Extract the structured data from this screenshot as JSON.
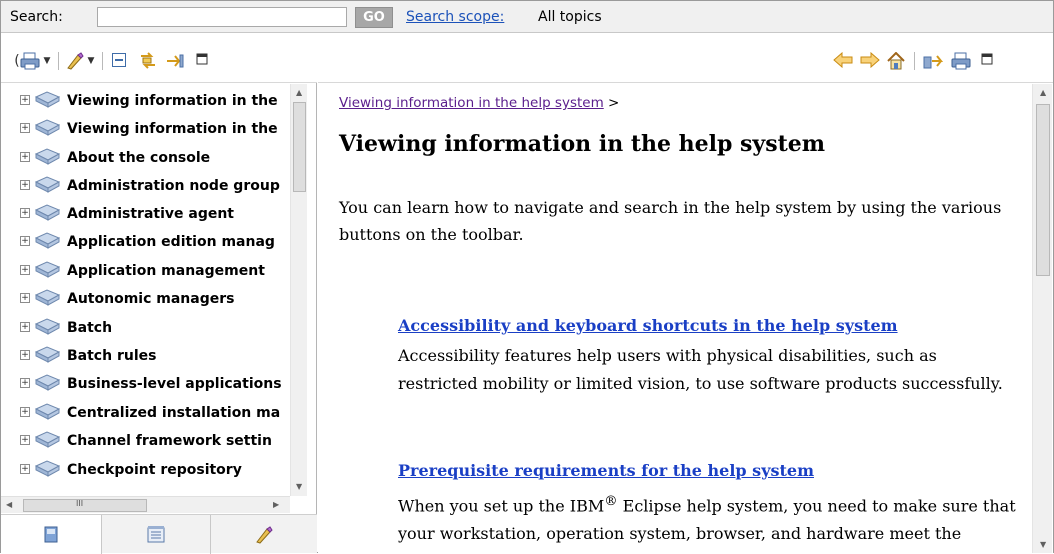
{
  "search": {
    "label": "Search:",
    "value": "",
    "placeholder": "",
    "go_label": "GO",
    "scope_link": "Search scope:",
    "scope_value": "All topics"
  },
  "toc": {
    "items": [
      {
        "label": "Viewing information in the"
      },
      {
        "label": "Viewing information in the"
      },
      {
        "label": "About the console"
      },
      {
        "label": "Administration node group"
      },
      {
        "label": "Administrative agent"
      },
      {
        "label": "Application edition manag"
      },
      {
        "label": "Application management"
      },
      {
        "label": "Autonomic managers"
      },
      {
        "label": "Batch"
      },
      {
        "label": "Batch rules"
      },
      {
        "label": "Business-level applications"
      },
      {
        "label": "Centralized installation ma"
      },
      {
        "label": "Channel framework settin"
      },
      {
        "label": "Checkpoint repository"
      }
    ],
    "expander_symbol": "+",
    "horizontal_scroll_thumb_glyph": "III"
  },
  "content": {
    "breadcrumb_link": "Viewing information in the help system",
    "breadcrumb_separator": ">",
    "title": "Viewing information in the help system",
    "intro": "You can learn how to navigate and search in the help system by using the various buttons on the toolbar.",
    "topics": [
      {
        "link": "Accessibility and keyboard shortcuts in the help system",
        "description": "Accessibility features help users with physical disabilities, such as restricted mobility or limited vision, to use software products successfully."
      },
      {
        "link": "Prerequisite requirements for the help system",
        "description_before": "When you set up the IBM",
        "description_sup": "®",
        "description_after": " Eclipse help system, you need to make sure that your workstation, operation system, browser, and hardware meet the requirements described in this topic."
      }
    ]
  },
  "colors": {
    "link_blue": "#1a3fc5",
    "visited_purple": "#5a1d8c",
    "toolbar_arrow_orange": "#e8a21a",
    "go_button_gray": "#a7a7a7"
  },
  "icons": {
    "left_toolbar": [
      "print-icon",
      "highlight-search-icon",
      "collapse-all-icon",
      "link-with-contents-icon",
      "show-in-toc-icon",
      "maximize-icon"
    ],
    "right_toolbar": [
      "back-icon",
      "forward-icon",
      "home-icon",
      "sync-toc-icon",
      "print-topic-icon",
      "maximize-icon"
    ],
    "tabs": [
      "contents-tab-icon",
      "index-tab-icon",
      "bookmarks-tab-icon"
    ]
  }
}
